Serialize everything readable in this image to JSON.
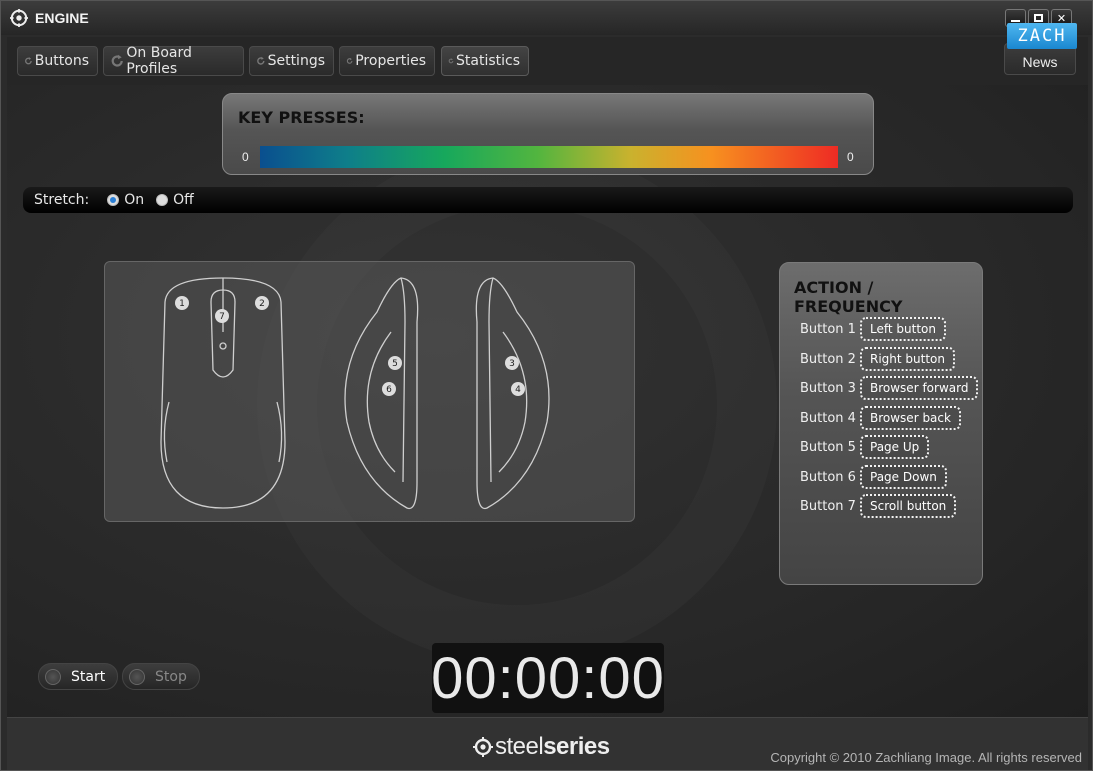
{
  "window": {
    "title": "ENGINE",
    "controls": [
      "minimize",
      "maximize",
      "close"
    ]
  },
  "toolbar": {
    "tabs": [
      {
        "label": "Buttons",
        "icon": "refresh-icon"
      },
      {
        "label": "On Board Profiles",
        "icon": "refresh-icon"
      },
      {
        "label": "Settings",
        "icon": "refresh-icon"
      },
      {
        "label": "Properties",
        "icon": "refresh-icon"
      },
      {
        "label": "Statistics",
        "icon": "refresh-icon",
        "active": true
      }
    ],
    "news_label": "News",
    "overlay_logo": "ZACH"
  },
  "key_presses": {
    "title": "KEY PRESSES:",
    "min": "0",
    "max": "0",
    "gradient": [
      "#0a4f8f",
      "#17a85c",
      "#c9b22e",
      "#f7911f",
      "#ee2b24"
    ]
  },
  "stretch": {
    "label": "Stretch:",
    "options": [
      "On",
      "Off"
    ],
    "selected": "On"
  },
  "mouse_diagram": {
    "markers": [
      "1",
      "2",
      "7",
      "5",
      "6",
      "3",
      "4"
    ]
  },
  "action_frequency": {
    "title": "ACTION / FREQUENCY",
    "rows": [
      {
        "button": "Button 1",
        "action": "Left button"
      },
      {
        "button": "Button 2",
        "action": "Right button"
      },
      {
        "button": "Button 3",
        "action": "Browser forward"
      },
      {
        "button": "Button 4",
        "action": "Browser back"
      },
      {
        "button": "Button 5",
        "action": "Page Up"
      },
      {
        "button": "Button 6",
        "action": "Page Down"
      },
      {
        "button": "Button 7",
        "action": "Scroll button"
      }
    ]
  },
  "controls": {
    "start_label": "Start",
    "stop_label": "Stop"
  },
  "timer": "00:00:00",
  "footer": {
    "brand_part1": "steel",
    "brand_part2": "series",
    "copyright": "Copyright © 2010 Zachliang Image. All rights reserved"
  }
}
